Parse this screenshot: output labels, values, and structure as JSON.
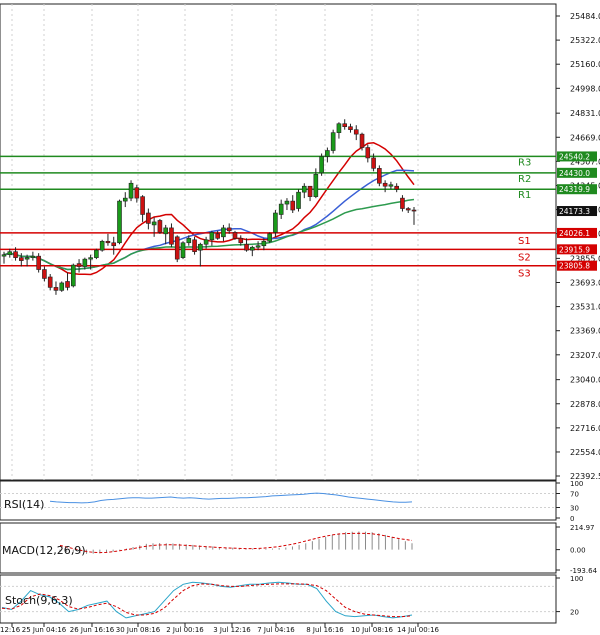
{
  "colors": {
    "resistance": "#1f8a1f",
    "support": "#d40000",
    "ma_fast": "#d40000",
    "ma_mid": "#3a5fd6",
    "ma_slow": "#2e9b4f",
    "candle_up": "#1a9a1a",
    "candle_down": "#cc1111",
    "rsi": "#4a90e2",
    "macd_hist": "#8a8a8a",
    "macd_signal": "#d40000",
    "stoch_k": "#2aa5c9",
    "stoch_d": "#d40000",
    "grid": "#d0d0d0"
  },
  "chart_data": [
    {
      "type": "candlestick",
      "title": "",
      "y_ticks": [
        "25484.0",
        "25322.0",
        "25160.0",
        "24998.0",
        "24831.0",
        "24669.0",
        "24507.0",
        "24345.0",
        "24183.0",
        "24021.0",
        "23855.0",
        "23693.0",
        "23531.0",
        "23369.0",
        "23207.0",
        "23040.0",
        "22878.0",
        "22716.0",
        "22554.0",
        "22392.5"
      ],
      "x_ticks": [
        "12:16",
        "25 Jun 04:16",
        "26 Jun 16:16",
        "30 Jun 08:16",
        "2 Jul 00:16",
        "3 Jul 12:16",
        "7 Jul 04:16",
        "8 Jul 16:16",
        "10 Jul 08:16",
        "14 Jul 00:16"
      ],
      "ylim": [
        22392.5,
        25484.0
      ],
      "candles": [
        [
          23870,
          23900,
          23820,
          23880
        ],
        [
          23880,
          23920,
          23860,
          23900
        ],
        [
          23900,
          23930,
          23840,
          23860
        ],
        [
          23860,
          23890,
          23800,
          23840
        ],
        [
          23850,
          23880,
          23800,
          23860
        ],
        [
          23860,
          23900,
          23840,
          23870
        ],
        [
          23870,
          23890,
          23760,
          23780
        ],
        [
          23780,
          23800,
          23700,
          23720
        ],
        [
          23730,
          23750,
          23640,
          23660
        ],
        [
          23660,
          23700,
          23610,
          23640
        ],
        [
          23640,
          23700,
          23630,
          23690
        ],
        [
          23700,
          23760,
          23640,
          23660
        ],
        [
          23670,
          23820,
          23660,
          23810
        ],
        [
          23820,
          23850,
          23760,
          23800
        ],
        [
          23800,
          23860,
          23780,
          23850
        ],
        [
          23850,
          23880,
          23780,
          23860
        ],
        [
          23860,
          23920,
          23850,
          23910
        ],
        [
          23910,
          23980,
          23900,
          23970
        ],
        [
          23970,
          24020,
          23940,
          23960
        ],
        [
          23960,
          24000,
          23880,
          23940
        ],
        [
          23960,
          24250,
          23950,
          24240
        ],
        [
          24240,
          24300,
          24200,
          24260
        ],
        [
          24260,
          24380,
          24240,
          24360
        ],
        [
          24330,
          24350,
          24230,
          24260
        ],
        [
          24270,
          24280,
          24100,
          24150
        ],
        [
          24160,
          24190,
          24050,
          24090
        ],
        [
          24080,
          24130,
          24000,
          24100
        ],
        [
          24110,
          24120,
          24020,
          24030
        ],
        [
          24020,
          24080,
          23950,
          24060
        ],
        [
          24060,
          24090,
          23930,
          23950
        ],
        [
          24000,
          24010,
          23830,
          23850
        ],
        [
          23860,
          23970,
          23850,
          23960
        ],
        [
          23960,
          24010,
          23940,
          23990
        ],
        [
          23980,
          24000,
          23880,
          23900
        ],
        [
          23910,
          23960,
          23800,
          23950
        ],
        [
          23950,
          24000,
          23920,
          23980
        ],
        [
          23980,
          24040,
          23940,
          24030
        ],
        [
          24020,
          24040,
          23980,
          23990
        ],
        [
          24000,
          24080,
          23970,
          24060
        ],
        [
          24060,
          24090,
          24020,
          24040
        ],
        [
          24030,
          24040,
          23980,
          23990
        ],
        [
          23990,
          24010,
          23940,
          23960
        ],
        [
          23950,
          23990,
          23900,
          23910
        ],
        [
          23910,
          23940,
          23870,
          23930
        ],
        [
          23930,
          23970,
          23910,
          23940
        ],
        [
          23940,
          23990,
          23910,
          23970
        ],
        [
          23970,
          24030,
          23960,
          24020
        ],
        [
          24030,
          24180,
          24000,
          24160
        ],
        [
          24150,
          24250,
          24120,
          24220
        ],
        [
          24220,
          24260,
          24180,
          24240
        ],
        [
          24240,
          24280,
          24160,
          24180
        ],
        [
          24190,
          24320,
          24170,
          24300
        ],
        [
          24300,
          24360,
          24260,
          24340
        ],
        [
          24340,
          24330,
          24240,
          24270
        ],
        [
          24270,
          24460,
          24260,
          24420
        ],
        [
          24430,
          24560,
          24410,
          24540
        ],
        [
          24540,
          24600,
          24500,
          24580
        ],
        [
          24580,
          24720,
          24560,
          24700
        ],
        [
          24700,
          24770,
          24660,
          24760
        ],
        [
          24760,
          24790,
          24720,
          24740
        ],
        [
          24740,
          24760,
          24700,
          24720
        ],
        [
          24720,
          24750,
          24650,
          24690
        ],
        [
          24690,
          24700,
          24580,
          24600
        ],
        [
          24600,
          24620,
          24500,
          24530
        ],
        [
          24530,
          24560,
          24440,
          24460
        ],
        [
          24460,
          24480,
          24340,
          24360
        ],
        [
          24360,
          24380,
          24300,
          24340
        ],
        [
          24340,
          24370,
          24320,
          24350
        ],
        [
          24340,
          24360,
          24300,
          24320
        ],
        [
          24260,
          24280,
          24170,
          24190
        ],
        [
          24190,
          24200,
          24160,
          24180
        ],
        [
          24180,
          24200,
          24080,
          24173
        ]
      ],
      "levels": [
        {
          "label": "R3",
          "value": "24540.2"
        },
        {
          "label": "R2",
          "value": "24430.0"
        },
        {
          "label": "R1",
          "value": "24319.9"
        },
        {
          "label": "S1",
          "value": "24026.1"
        },
        {
          "label": "S2",
          "value": "23915.9"
        },
        {
          "label": "S3",
          "value": "23805.8"
        }
      ],
      "current_price": "24173.3"
    },
    {
      "type": "line",
      "title": "RSI(14)",
      "y_ticks": [
        "100",
        "70",
        "30",
        "0"
      ],
      "ylim": [
        0,
        100
      ],
      "values": [
        48,
        46,
        45,
        44,
        44,
        43,
        44,
        46,
        50,
        52,
        53,
        55,
        57,
        58,
        58,
        57,
        57,
        58,
        59,
        60,
        58,
        57,
        58,
        57,
        55,
        54,
        55,
        56,
        56,
        57,
        58,
        58,
        59,
        60,
        61,
        63,
        64,
        65,
        66,
        67,
        68,
        70,
        71,
        70,
        68,
        66,
        63,
        60,
        58,
        56,
        54,
        52,
        50,
        48,
        46,
        45,
        45,
        46
      ]
    },
    {
      "type": "bar",
      "title": "MACD(12,26,9)",
      "y_ticks": [
        "214.97",
        "0.00",
        "-193.64"
      ],
      "ylim": [
        -193.64,
        214.97
      ],
      "hist": [
        -20,
        -25,
        -30,
        -35,
        -40,
        -38,
        -35,
        -30,
        -20,
        -5,
        10,
        25,
        40,
        55,
        60,
        62,
        60,
        58,
        55,
        50,
        45,
        40,
        35,
        30,
        25,
        20,
        18,
        15,
        12,
        10,
        8,
        8,
        10,
        15,
        20,
        30,
        45,
        60,
        80,
        100,
        120,
        140,
        155,
        165,
        170,
        172,
        170,
        165,
        155,
        140,
        120,
        100,
        80,
        60
      ],
      "signal": [
        40,
        25,
        10,
        -5,
        -18,
        -25,
        -28,
        -26,
        -20,
        -10,
        0,
        10,
        22,
        32,
        40,
        44,
        46,
        46,
        44,
        40,
        36,
        32,
        28,
        24,
        20,
        16,
        14,
        12,
        10,
        10,
        12,
        16,
        22,
        30,
        40,
        52,
        66,
        82,
        98,
        114,
        128,
        140,
        148,
        152,
        154,
        155,
        154,
        150,
        142,
        130,
        118,
        106,
        96,
        88
      ]
    },
    {
      "type": "line",
      "title": "Stoch(9,6,3)",
      "y_ticks": [
        "100",
        "20"
      ],
      "ylim": [
        0,
        100
      ],
      "k": [
        30,
        25,
        45,
        70,
        60,
        55,
        40,
        20,
        25,
        35,
        40,
        45,
        20,
        5,
        10,
        15,
        20,
        45,
        70,
        85,
        90,
        88,
        85,
        80,
        78,
        82,
        85,
        85,
        88,
        90,
        88,
        85,
        85,
        75,
        45,
        20,
        10,
        8,
        10,
        12,
        8,
        5,
        8,
        12
      ],
      "d": [
        28,
        26,
        35,
        55,
        62,
        58,
        48,
        32,
        26,
        30,
        36,
        40,
        32,
        18,
        12,
        12,
        16,
        28,
        50,
        70,
        82,
        86,
        85,
        82,
        80,
        80,
        82,
        84,
        85,
        86,
        86,
        86,
        85,
        82,
        70,
        50,
        30,
        20,
        14,
        12,
        10,
        8,
        8,
        10
      ]
    }
  ]
}
